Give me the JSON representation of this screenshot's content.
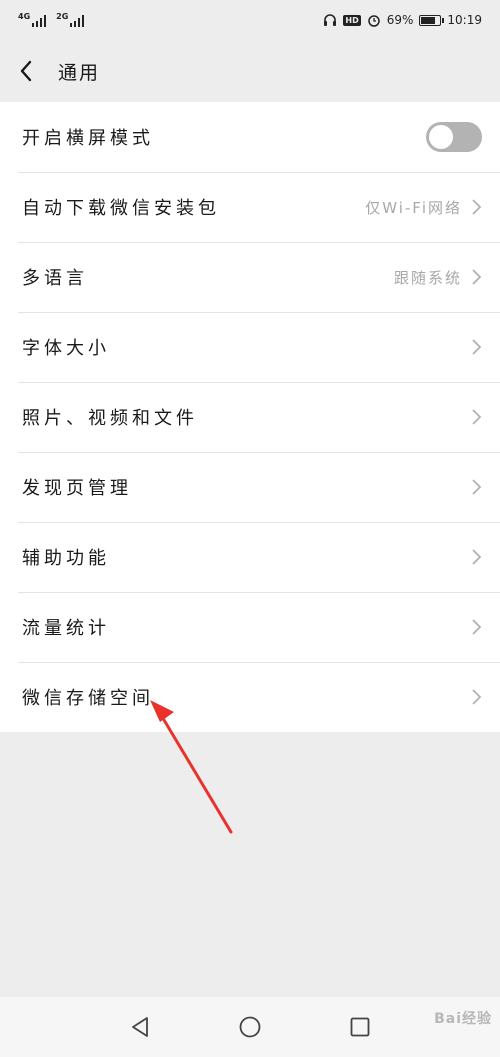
{
  "status_bar": {
    "network1": "4G",
    "network2": "2G",
    "hd_badge": "HD",
    "battery_text": "69%",
    "battery_level": 0.69,
    "time": "10:19"
  },
  "header": {
    "title": "通用",
    "back_icon": "chevron-left-icon"
  },
  "settings": {
    "items": [
      {
        "label": "开启横屏模式",
        "value": "",
        "control": "toggle",
        "toggle_on": false
      },
      {
        "label": "自动下载微信安装包",
        "value": "仅Wi-Fi网络",
        "control": "chevron"
      },
      {
        "label": "多语言",
        "value": "跟随系统",
        "control": "chevron"
      },
      {
        "label": "字体大小",
        "value": "",
        "control": "chevron"
      },
      {
        "label": "照片、视频和文件",
        "value": "",
        "control": "chevron"
      },
      {
        "label": "发现页管理",
        "value": "",
        "control": "chevron"
      },
      {
        "label": "辅助功能",
        "value": "",
        "control": "chevron"
      },
      {
        "label": "流量统计",
        "value": "",
        "control": "chevron"
      },
      {
        "label": "微信存储空间",
        "value": "",
        "control": "chevron"
      }
    ]
  },
  "annotation": {
    "color": "#e8322b"
  },
  "nav_bar": {
    "back_icon": "triangle-back-icon",
    "home_icon": "circle-home-icon",
    "recent_icon": "square-recent-icon"
  },
  "watermark": {
    "text": "Bai经验"
  }
}
